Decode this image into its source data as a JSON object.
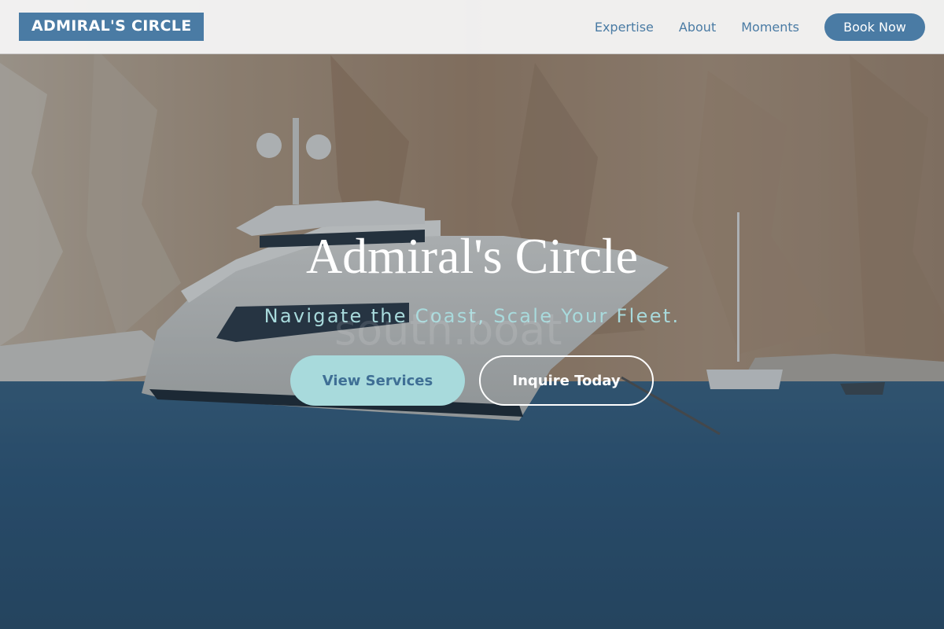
{
  "navbar": {
    "brand": "ADMIRAL'S CIRCLE",
    "links": [
      "Expertise",
      "About",
      "Moments"
    ],
    "cta": "Book Now"
  },
  "hero": {
    "title": "Admiral's Circle",
    "subtitle": "Navigate the Coast, Scale Your Fleet.",
    "primary_button": "View Services",
    "secondary_button": "Inquire Today",
    "watermark": "south.boat"
  },
  "colors": {
    "accent": "#4a7ba4",
    "highlight": "#a8dadc",
    "nav_background": "#f5f5f5"
  }
}
